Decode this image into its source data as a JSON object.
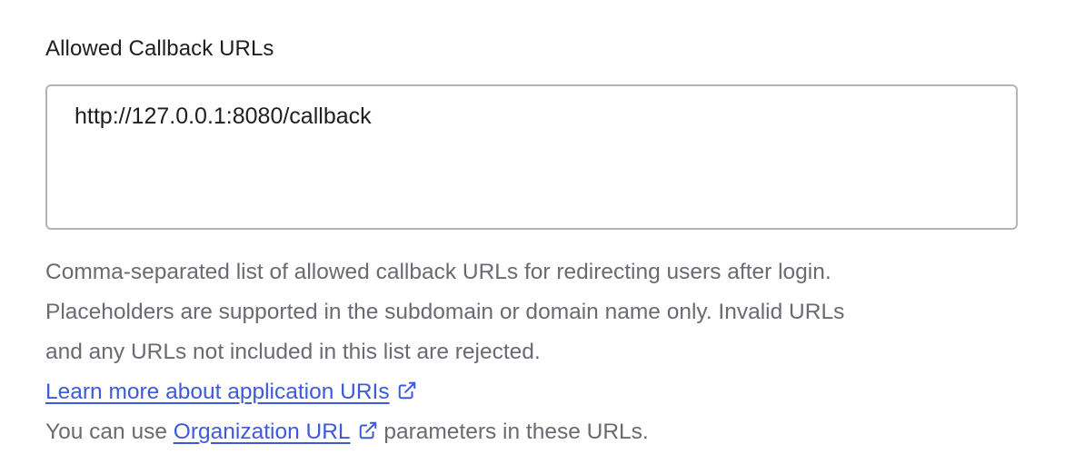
{
  "field": {
    "label": "Allowed Callback URLs",
    "value": "http://127.0.0.1:8080/callback",
    "placeholder": ""
  },
  "help": {
    "line1": "Comma-separated list of allowed callback URLs for redirecting users after login.",
    "line2": "Placeholders are supported in the subdomain or domain name only. Invalid URLs",
    "line3": "and any URLs not included in this list are rejected.",
    "learn_more_link": "Learn more about application URIs",
    "org_prefix": "You can use ",
    "org_link": "Organization URL",
    "org_suffix": " parameters in these URLs."
  },
  "icons": {
    "external_link": "external-link-icon"
  },
  "colors": {
    "link": "#3d5bd9",
    "help_text": "#6a6a72",
    "label_text": "#1f1f23",
    "border": "#b3b3b8"
  }
}
